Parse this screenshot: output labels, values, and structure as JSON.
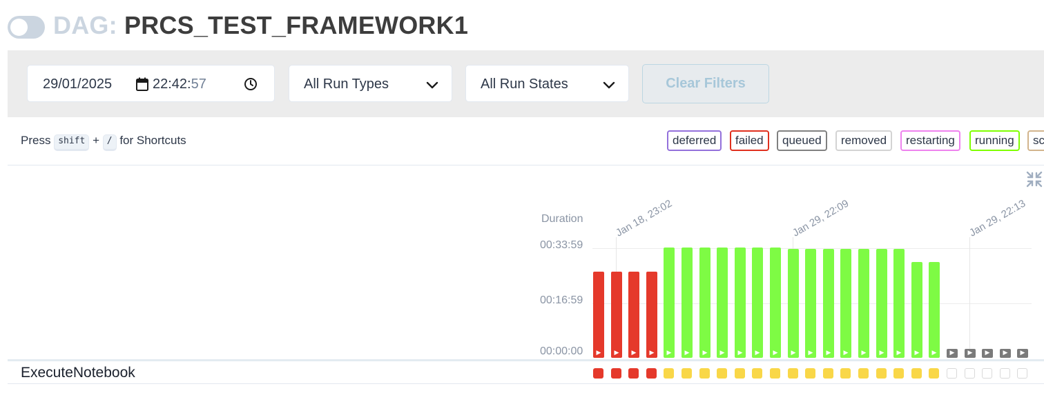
{
  "header": {
    "dag_label": "DAG:",
    "dag_id": "PRCS_TEST_FRAMEWORK1"
  },
  "filters": {
    "date": "29/01/2025",
    "time_hm": "22:42:",
    "time_sec": "57",
    "run_type": "All Run Types",
    "run_state": "All Run States",
    "clear_label": "Clear Filters"
  },
  "shortcuts": {
    "press": "Press",
    "key1": "shift",
    "plus": "+",
    "key2": "/",
    "suffix": "for Shortcuts"
  },
  "legend": [
    {
      "label": "deferred",
      "color": "#9370db"
    },
    {
      "label": "failed",
      "color": "#e0301e"
    },
    {
      "label": "queued",
      "color": "#808080"
    },
    {
      "label": "removed",
      "color": "#d3d3d3"
    },
    {
      "label": "restarting",
      "color": "#ee82ee"
    },
    {
      "label": "running",
      "color": "#7fff00"
    },
    {
      "label": "scheduled",
      "color": "#d2b48c"
    }
  ],
  "grid": {
    "duration_label": "Duration",
    "ticks": [
      "00:33:59",
      "00:16:59",
      "00:00:00"
    ],
    "date_labels": [
      "Jan 18, 23:02",
      "Jan 29, 22:09",
      "Jan 29, 22:13"
    ],
    "task_name": "ExecuteNotebook"
  },
  "runs": [
    {
      "state": "failed",
      "duration_fraction": 0.78,
      "task_state": "failed"
    },
    {
      "state": "failed",
      "duration_fraction": 0.78,
      "task_state": "failed"
    },
    {
      "state": "failed",
      "duration_fraction": 0.78,
      "task_state": "failed"
    },
    {
      "state": "failed",
      "duration_fraction": 0.78,
      "task_state": "failed"
    },
    {
      "state": "success",
      "duration_fraction": 1.0,
      "task_state": "up_for_retry"
    },
    {
      "state": "success",
      "duration_fraction": 1.0,
      "task_state": "up_for_retry"
    },
    {
      "state": "success",
      "duration_fraction": 1.0,
      "task_state": "up_for_retry"
    },
    {
      "state": "success",
      "duration_fraction": 1.0,
      "task_state": "up_for_retry"
    },
    {
      "state": "success",
      "duration_fraction": 1.0,
      "task_state": "up_for_retry"
    },
    {
      "state": "success",
      "duration_fraction": 1.0,
      "task_state": "up_for_retry"
    },
    {
      "state": "success",
      "duration_fraction": 1.0,
      "task_state": "up_for_retry"
    },
    {
      "state": "success",
      "duration_fraction": 0.99,
      "task_state": "up_for_retry"
    },
    {
      "state": "success",
      "duration_fraction": 0.99,
      "task_state": "up_for_retry"
    },
    {
      "state": "success",
      "duration_fraction": 0.99,
      "task_state": "up_for_retry"
    },
    {
      "state": "success",
      "duration_fraction": 0.99,
      "task_state": "up_for_retry"
    },
    {
      "state": "success",
      "duration_fraction": 0.99,
      "task_state": "up_for_retry"
    },
    {
      "state": "success",
      "duration_fraction": 0.99,
      "task_state": "up_for_retry"
    },
    {
      "state": "success",
      "duration_fraction": 0.99,
      "task_state": "up_for_retry"
    },
    {
      "state": "success",
      "duration_fraction": 0.87,
      "task_state": "up_for_retry"
    },
    {
      "state": "success",
      "duration_fraction": 0.87,
      "task_state": "up_for_retry"
    },
    {
      "state": "queued",
      "duration_fraction": 0.08,
      "task_state": "none"
    },
    {
      "state": "queued",
      "duration_fraction": 0.08,
      "task_state": "none"
    },
    {
      "state": "queued",
      "duration_fraction": 0.08,
      "task_state": "none"
    },
    {
      "state": "queued",
      "duration_fraction": 0.08,
      "task_state": "none"
    },
    {
      "state": "queued",
      "duration_fraction": 0.08,
      "task_state": "none"
    }
  ],
  "state_colors": {
    "failed": "#e5392b",
    "success": "#7efb44",
    "queued": "#7a7a7a",
    "up_for_retry": "#f9d748",
    "none": "#ffffff"
  }
}
